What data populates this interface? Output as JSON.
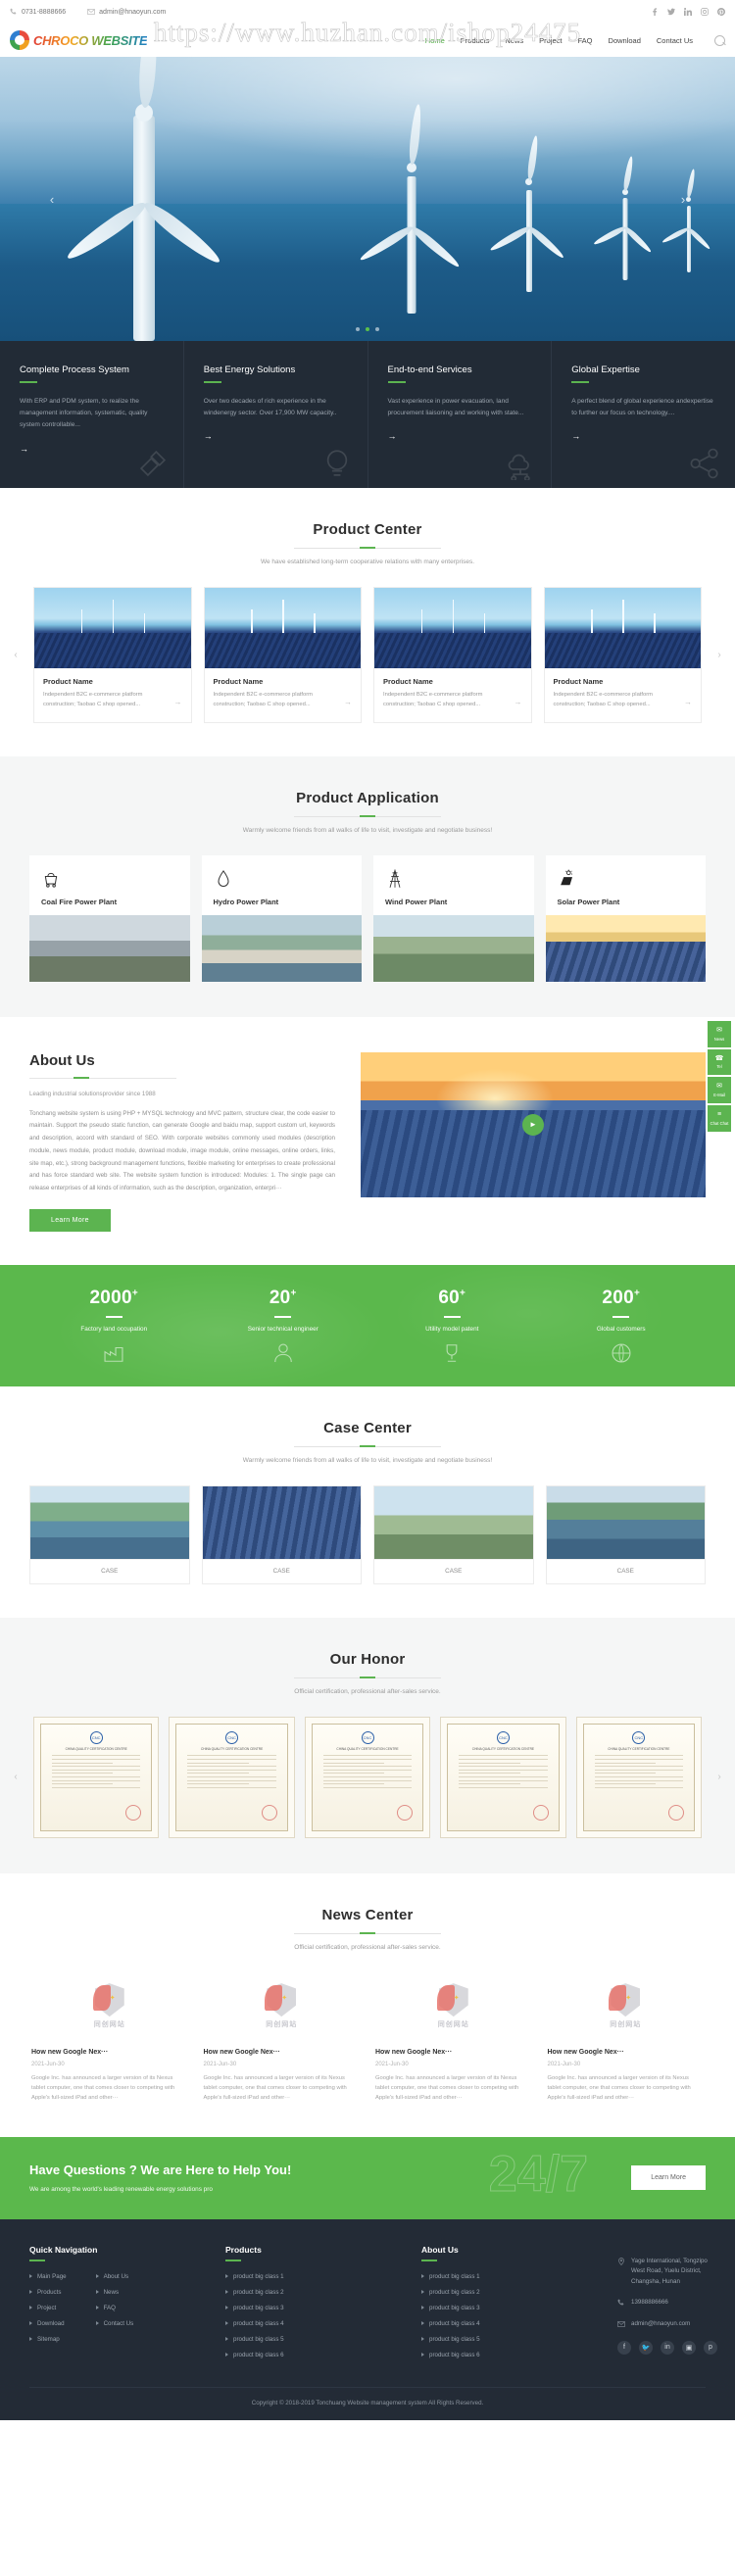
{
  "topbar": {
    "phone": "0731-8888666",
    "email": "admin@hnaoyun.com",
    "socials": [
      "facebook-icon",
      "twitter-icon",
      "linkedin-icon",
      "instagram-icon",
      "pinterest-icon"
    ]
  },
  "header": {
    "logo_text": "CHROCO WEBSITE",
    "nav": [
      {
        "label": "Home",
        "active": true
      },
      {
        "label": "Products",
        "active": false
      },
      {
        "label": "News",
        "active": false
      },
      {
        "label": "Project",
        "active": false
      },
      {
        "label": "FAQ",
        "active": false
      },
      {
        "label": "Download",
        "active": false
      },
      {
        "label": "Contact Us",
        "active": false
      }
    ],
    "search_icon": "search-icon"
  },
  "watermark": "https://www.huzhan.com/ishop24475",
  "hero": {
    "prev": "‹",
    "next": "›",
    "slides": 3,
    "active_slide": 2
  },
  "features": [
    {
      "title": "Complete Process System",
      "text": "With ERP and PDM system, to realize the management information, systematic, quality system controllable...",
      "arrow": "→",
      "icon": "tools-icon"
    },
    {
      "title": "Best Energy Solutions",
      "text": "Over two decades of rich experience in the windenergy sector. Over 17,900 MW capacity..",
      "arrow": "→",
      "icon": "lightbulb-icon"
    },
    {
      "title": "End-to-end Services",
      "text": "Vast experience in power evacuation, land procurement liaisoning and working with state...",
      "arrow": "→",
      "icon": "cloud-network-icon"
    },
    {
      "title": "Global Expertise",
      "text": "A perfect blend of global experience andexpertise to further our focus on technology....",
      "arrow": "→",
      "icon": "share-icon"
    }
  ],
  "product_center": {
    "title": "Product Center",
    "subtitle": "We have established long-term cooperative relations with many enterprises.",
    "prev": "‹",
    "next": "›",
    "cards": [
      {
        "name": "Product Name",
        "desc": "Independent B2C e-commerce platform construction; Taobao C shop opened...",
        "arrow": "→"
      },
      {
        "name": "Product Name",
        "desc": "Independent B2C e-commerce platform construction; Taobao C shop opened...",
        "arrow": "→"
      },
      {
        "name": "Product Name",
        "desc": "Independent B2C e-commerce platform construction; Taobao C shop opened...",
        "arrow": "→"
      },
      {
        "name": "Product Name",
        "desc": "Independent B2C e-commerce platform construction; Taobao C shop opened...",
        "arrow": "→"
      }
    ]
  },
  "product_application": {
    "title": "Product Application",
    "subtitle": "Warmly welcome friends from all walks of life to visit, investigate and negotiate business!",
    "items": [
      {
        "label": "Coal Fire Power Plant",
        "icon": "coal-cart-icon"
      },
      {
        "label": "Hydro Power Plant",
        "icon": "water-drop-icon"
      },
      {
        "label": "Wind Power Plant",
        "icon": "pylon-icon"
      },
      {
        "label": "Solar Power Plant",
        "icon": "solar-panel-icon"
      }
    ]
  },
  "about": {
    "title": "About Us",
    "tagline": "Leading industrial solutionsprovider since 1988",
    "body": "Tonchang website system is using PHP + MYSQL technology and MVC pattern, structure clear, the code easier to maintain. Support the pseudo static function, can generate Google and baidu map, support custom url, keywords and description, accord with standard of SEO. With corporate websites commonly used modules (description module, news module, product module, download module, image module, online messages, online orders, links, site map, etc.), strong background management functions, flexible marketing for enterprises to create professional and has force standard web site. The website system function is introduced: Modules: 1. The single page can release enterprises of all kinds of information, such as the description, organization, enterpri···",
    "button": "Learn More",
    "play_icon": "play-icon"
  },
  "stats": [
    {
      "number": "2000",
      "plus": "+",
      "label": "Factory land occupation",
      "icon": "factory-icon"
    },
    {
      "number": "20",
      "plus": "+",
      "label": "Senior technical engineer",
      "icon": "person-icon"
    },
    {
      "number": "60",
      "plus": "+",
      "label": "Utility model patent",
      "icon": "trophy-icon"
    },
    {
      "number": "200",
      "plus": "+",
      "label": "Global customers",
      "icon": "globe-icon"
    }
  ],
  "case_center": {
    "title": "Case Center",
    "subtitle": "Warmly welcome friends from all walks of life to visit, investigate and negotiate business!",
    "cards": [
      {
        "caption": "CASE"
      },
      {
        "caption": "CASE"
      },
      {
        "caption": "CASE"
      },
      {
        "caption": "CASE"
      }
    ]
  },
  "honor": {
    "title": "Our Honor",
    "subtitle": "Official certification, professional after-sales service.",
    "prev": "‹",
    "next": "›",
    "certs": [
      {
        "seal": "CNC",
        "heading": "CHINA QUALITY CERTIFICATION CENTRE"
      },
      {
        "seal": "CNC",
        "heading": "CHINA QUALITY CERTIFICATION CENTRE"
      },
      {
        "seal": "CNC",
        "heading": "CHINA QUALITY CERTIFICATION CENTRE"
      },
      {
        "seal": "CNC",
        "heading": "CHINA QUALITY CERTIFICATION CENTRE"
      },
      {
        "seal": "CNC",
        "heading": "CHINA QUALITY CERTIFICATION CENTRE"
      }
    ]
  },
  "news": {
    "title": "News Center",
    "subtitle": "Official certification, professional after-sales service.",
    "logo_cn": "同创网站",
    "cards": [
      {
        "title": "How new Google Nex···",
        "date": "2021-Jun-30",
        "excerpt": "Google Inc. has announced a larger version of its Nexus tablet computer, one that comes closer to competing with Apple's full-sized iPad and other···"
      },
      {
        "title": "How new Google Nex···",
        "date": "2021-Jun-30",
        "excerpt": "Google Inc. has announced a larger version of its Nexus tablet computer, one that comes closer to competing with Apple's full-sized iPad and other···"
      },
      {
        "title": "How new Google Nex···",
        "date": "2021-Jun-30",
        "excerpt": "Google Inc. has announced a larger version of its Nexus tablet computer, one that comes closer to competing with Apple's full-sized iPad and other···"
      },
      {
        "title": "How new Google Nex···",
        "date": "2021-Jun-30",
        "excerpt": "Google Inc. has announced a larger version of its Nexus tablet computer, one that comes closer to competing with Apple's full-sized iPad and other···"
      }
    ]
  },
  "cta": {
    "title": "Have Questions ? We are Here to Help You!",
    "subtitle": "We are among the world's leading renewable energy solutions pro",
    "big_text": "24/7",
    "button": "Learn More"
  },
  "footer": {
    "quick_nav": {
      "title": "Quick Navigation",
      "col1": [
        "Main Page",
        "Products",
        "Project",
        "Download",
        "Sitemap"
      ],
      "col2": [
        "About Us",
        "News",
        "FAQ",
        "Contact Us"
      ]
    },
    "products": {
      "title": "Products",
      "items": [
        "product big class 1",
        "product big class 2",
        "product big class 3",
        "product big class 4",
        "product big class 5",
        "product big class 6"
      ]
    },
    "about": {
      "title": "About Us",
      "items": [
        "product big class 1",
        "product big class 2",
        "product big class 3",
        "product big class 4",
        "product big class 5",
        "product big class 6"
      ]
    },
    "contact": {
      "address": "Yage International, Tongzipo West Road, Yuelu District, Changsha, Hunan",
      "phone": "13988886666",
      "email": "admin@hnaoyun.com",
      "socials": [
        "facebook-icon",
        "twitter-icon",
        "linkedin-icon",
        "instagram-icon",
        "pinterest-icon"
      ]
    },
    "copyright": "Copyright © 2018-2019 Tonchuang Website management system All Rights Reserved."
  },
  "side_widget": [
    {
      "icon": "✉",
      "label": "News"
    },
    {
      "icon": "☎",
      "label": "Tel"
    },
    {
      "icon": "✉",
      "label": "E-Mail"
    },
    {
      "icon": "≡",
      "label": "Chat Chat"
    }
  ],
  "colors": {
    "green": "#5cb450",
    "dark": "#232b36"
  }
}
